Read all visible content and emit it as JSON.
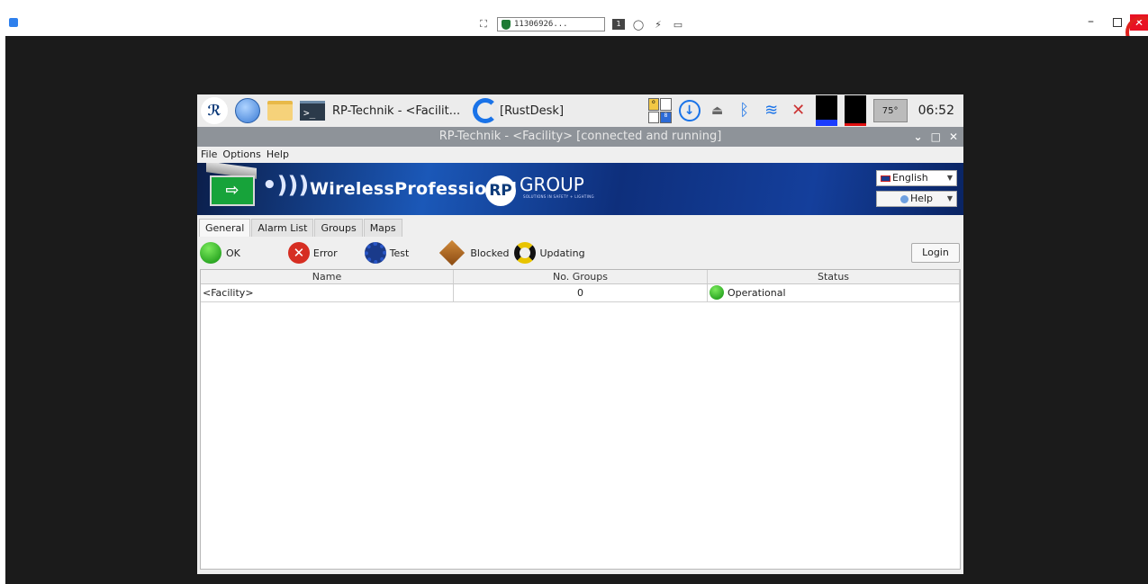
{
  "rustdesk": {
    "peer_id": "11306926...",
    "monitor_number": "1",
    "close_label": "✕"
  },
  "taskbar": {
    "window_task_label": "RP-Technik - <Facilit...",
    "rustdesk_task_label": "[RustDesk]",
    "temperature": "75°",
    "clock": "06:52"
  },
  "window": {
    "title": "RP-Technik - <Facility> [connected and running]"
  },
  "menu": {
    "file": "File",
    "options": "Options",
    "help": "Help"
  },
  "banner": {
    "product": "WirelessProfessional",
    "rp_logo": "RP",
    "group": "GROUP",
    "tagline": "SOLUTIONS IN SAFETY + LIGHTING",
    "language": "English",
    "help": "Help"
  },
  "tabs": [
    {
      "label": "General",
      "active": true
    },
    {
      "label": "Alarm List"
    },
    {
      "label": "Groups"
    },
    {
      "label": "Maps"
    }
  ],
  "legend": {
    "ok": "OK",
    "error": "Error",
    "test": "Test",
    "blocked": "Blocked",
    "updating": "Updating",
    "login": "Login"
  },
  "table": {
    "columns": [
      "Name",
      "No. Groups",
      "Status"
    ],
    "rows": [
      {
        "name": "<Facility>",
        "groups": "0",
        "status": "Operational"
      }
    ]
  },
  "colors": {
    "titlebar": "#8e9399",
    "banner": "#1b58b8",
    "ok_green": "#0f8f0f",
    "error_red": "#d62e22"
  }
}
